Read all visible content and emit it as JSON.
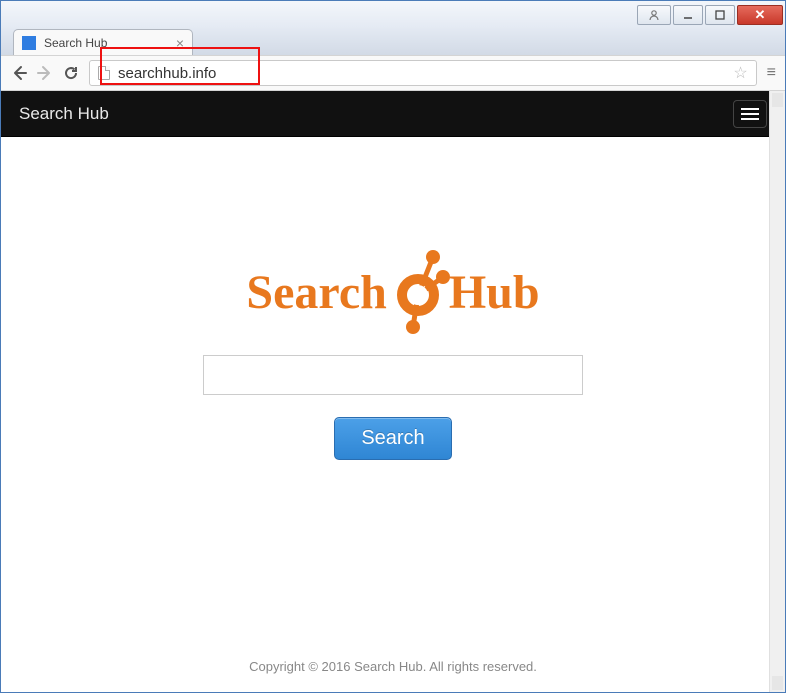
{
  "window": {
    "tab_title": "Search Hub"
  },
  "address_bar": {
    "url": "searchhub.info"
  },
  "site": {
    "header_title": "Search Hub",
    "logo_part1": "Search",
    "logo_part2": "Hub",
    "search_button": "Search",
    "footer": "Copyright © 2016 Search Hub. All rights reserved."
  },
  "colors": {
    "accent_orange": "#e8781e",
    "button_blue": "#3a91dc"
  }
}
